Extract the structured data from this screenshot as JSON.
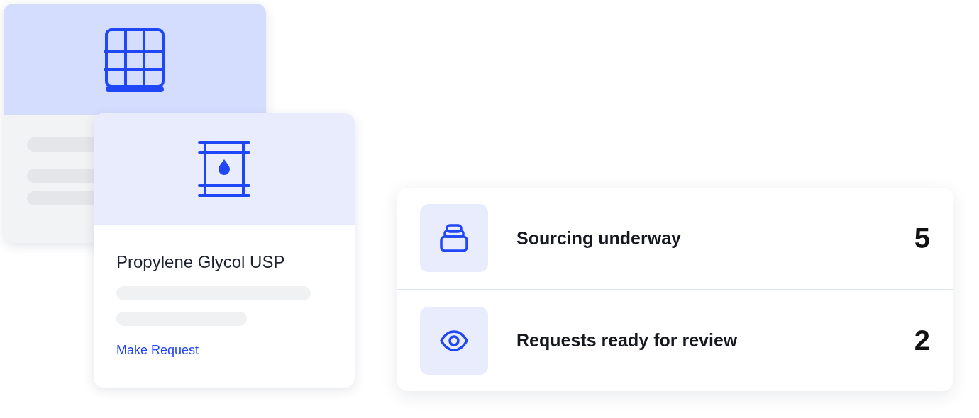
{
  "product_card": {
    "title": "Propylene Glycol USP",
    "link": "Make Request"
  },
  "stats": [
    {
      "kind": "jar",
      "label": "Sourcing underway",
      "count": "5"
    },
    {
      "kind": "eye",
      "label": "Requests ready for review",
      "count": "2"
    }
  ]
}
